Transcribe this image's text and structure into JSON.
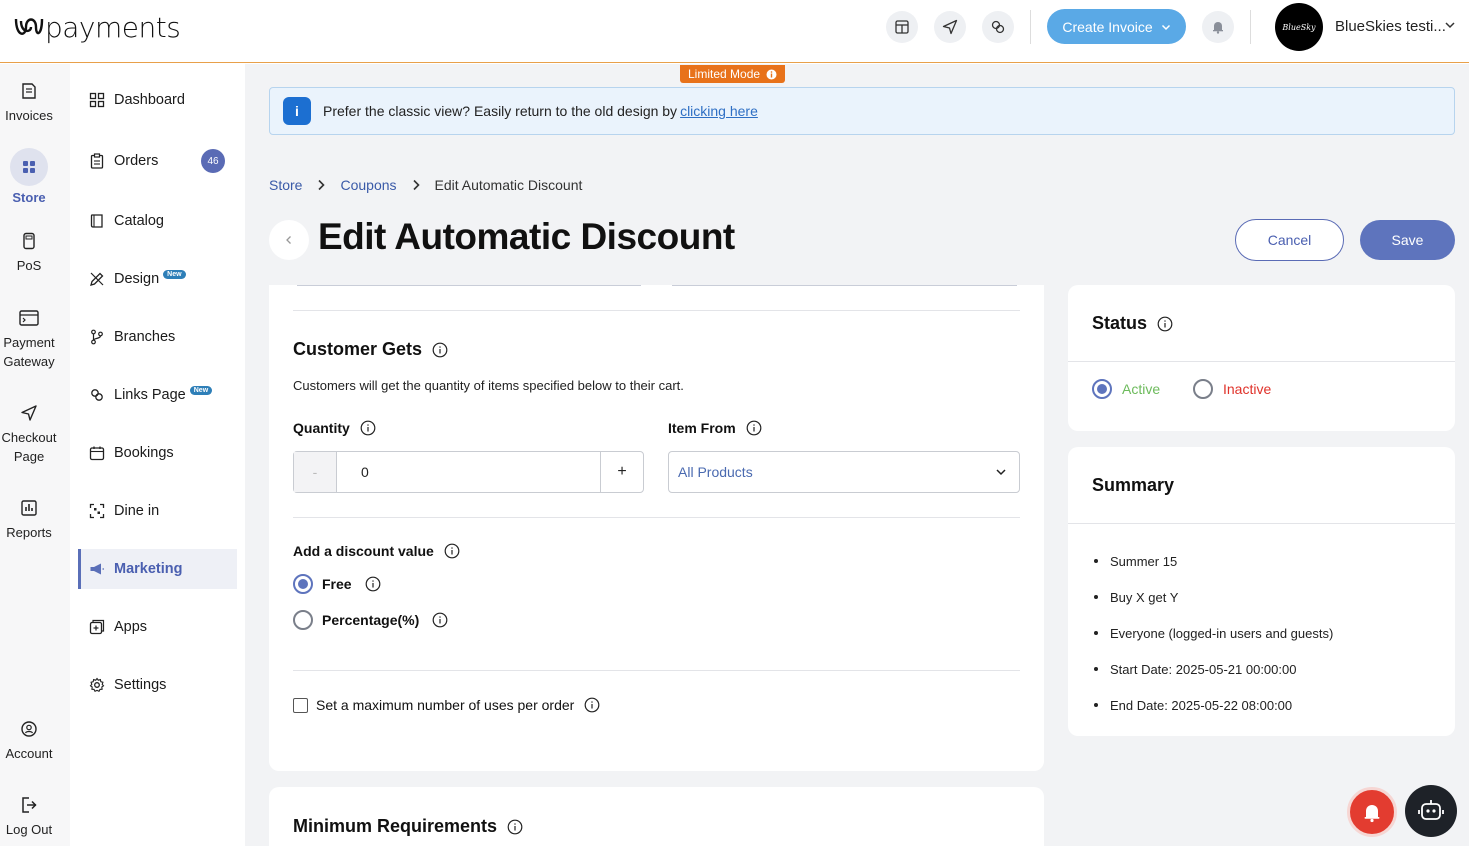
{
  "app": {
    "brand": "payments",
    "create_invoice_label": "Create Invoice",
    "account_name": "BlueSkies testi...",
    "avatar_text": "BlueSky"
  },
  "rail": {
    "invoices": "Invoices",
    "store": "Store",
    "pos": "PoS",
    "payment_gateway_1": "Payment",
    "payment_gateway_2": "Gateway",
    "checkout_1": "Checkout",
    "checkout_2": "Page",
    "reports": "Reports",
    "account": "Account",
    "logout": "Log Out"
  },
  "sidebar": {
    "items": [
      {
        "label": "Dashboard",
        "icon": "grid-icon"
      },
      {
        "label": "Orders",
        "icon": "clipboard-icon",
        "badge": "46"
      },
      {
        "label": "Catalog",
        "icon": "book-icon"
      },
      {
        "label": "Design",
        "icon": "pencil-ruler-icon",
        "tag": "New"
      },
      {
        "label": "Branches",
        "icon": "git-branch-icon"
      },
      {
        "label": "Links Page",
        "icon": "link-icon",
        "tag": "New"
      },
      {
        "label": "Bookings",
        "icon": "calendar-icon"
      },
      {
        "label": "Dine in",
        "icon": "qr-icon"
      },
      {
        "label": "Marketing",
        "icon": "megaphone-icon"
      },
      {
        "label": "Apps",
        "icon": "apps-icon"
      },
      {
        "label": "Settings",
        "icon": "gear-icon"
      }
    ]
  },
  "limited_mode": "Limited Mode",
  "banner": {
    "text": "Prefer the classic view? Easily return to the old design by",
    "link": "clicking here"
  },
  "breadcrumb": [
    "Store",
    "Coupons",
    "Edit Automatic Discount"
  ],
  "page_title": "Edit Automatic Discount",
  "actions": {
    "cancel": "Cancel",
    "save": "Save"
  },
  "customer_gets": {
    "title": "Customer Gets",
    "description": "Customers will get the quantity of items specified below to their cart.",
    "quantity_label": "Quantity",
    "quantity_value": "0",
    "minus": "-",
    "plus": "+",
    "item_from_label": "Item From",
    "item_from_value": "All Products"
  },
  "discount": {
    "title": "Add a discount value",
    "options": [
      {
        "label": "Free",
        "selected": true
      },
      {
        "label": "Percentage(%)",
        "selected": false
      }
    ]
  },
  "max_uses": {
    "label": "Set a maximum number of uses per order",
    "checked": false
  },
  "minimum_requirements": {
    "title": "Minimum Requirements"
  },
  "status": {
    "title": "Status",
    "active": "Active",
    "inactive": "Inactive",
    "selected": "Active",
    "colors": {
      "active": "#6dbb5c",
      "inactive": "#e0322a"
    }
  },
  "summary": {
    "title": "Summary",
    "items": [
      "Summer 15",
      "Buy X get Y",
      "Everyone (logged-in users and guests)",
      "Start Date: 2025-05-21 00:00:00",
      "End Date: 2025-05-22 08:00:00"
    ]
  }
}
